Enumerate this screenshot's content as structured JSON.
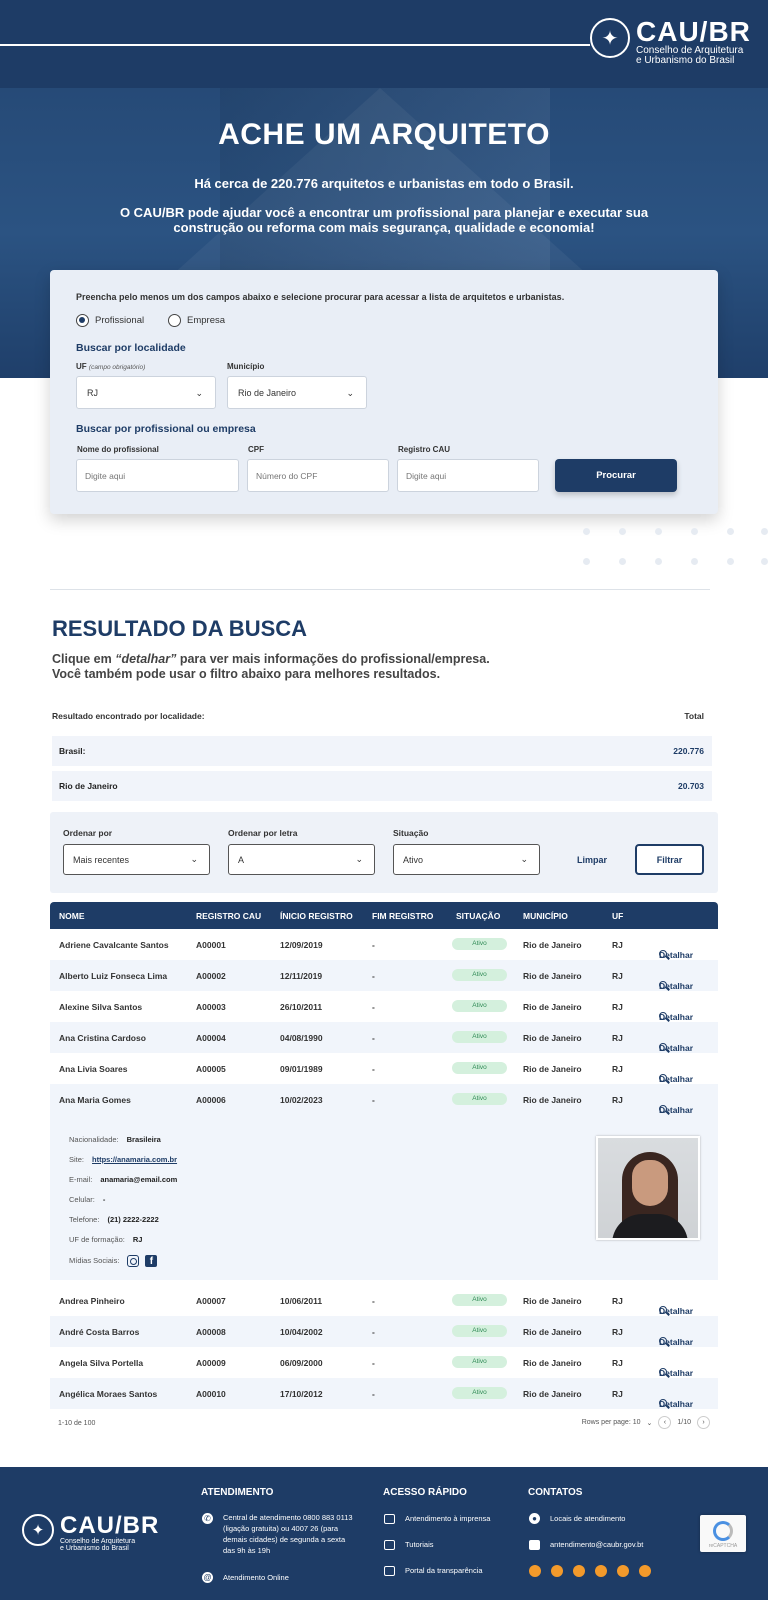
{
  "header": {
    "brand": "CAU/BR",
    "brand_sub_1": "Conselho de Arquitetura",
    "brand_sub_2": "e Urbanismo do Brasil"
  },
  "hero": {
    "title": "ACHE UM ARQUITETO",
    "line1": "Há cerca de 220.776 arquitetos e urbanistas em todo o Brasil.",
    "line2": "O CAU/BR pode ajudar você a encontrar um profissional para planejar e executar sua construção ou reforma com mais segurança, qualidade e economia!"
  },
  "search": {
    "instructions": "Preencha pelo menos um dos campos abaixo e selecione procurar para acessar a lista de arquitetos e urbanistas.",
    "radio_profissional": "Profissional",
    "radio_empresa": "Empresa",
    "section_localidade": "Buscar por localidade",
    "uf_label": "UF",
    "uf_note": "(campo obrigatório)",
    "uf_value": "RJ",
    "municipio_label": "Município",
    "municipio_value": "Rio de Janeiro",
    "section_profissional": "Buscar por profissional ou empresa",
    "nome_label": "Nome do profissional",
    "nome_placeholder": "Digite aqui",
    "cpf_label": "CPF",
    "cpf_placeholder": "Número do CPF",
    "registro_label": "Registro CAU",
    "registro_placeholder": "Digite aqui",
    "button": "Procurar"
  },
  "results": {
    "title": "RESULTADO DA BUSCA",
    "sub_pre": "Clique em ",
    "sub_em": "“detalhar”",
    "sub_post": " para ver mais informações do profissional/empresa.",
    "sub_line2": "Você também pode usar o filtro abaixo para melhores resultados.",
    "loc_header": "Resultado encontrado por localidade:",
    "total_header": "Total",
    "brasil_label": "Brasil:",
    "brasil_total": "220.776",
    "rj_label": "Rio de Janeiro",
    "rj_total": "20.703"
  },
  "filters": {
    "ordenar_label": "Ordenar por",
    "ordenar_value": "Mais recentes",
    "letra_label": "Ordenar por letra",
    "letra_value": "A",
    "situacao_label": "Situação",
    "situacao_value": "Ativo",
    "limpar": "Limpar",
    "filtrar": "Filtrar"
  },
  "table": {
    "columns": [
      "NOME",
      "REGISTRO CAU",
      "ÍNICIO REGISTRO",
      "FIM REGISTRO",
      "SITUAÇÃO",
      "MUNICÍPIO",
      "UF"
    ],
    "detail_label": "Detalhar",
    "rows": [
      {
        "nome": "Adriene Cavalcante Santos",
        "registro": "A00001",
        "inicio": "12/09/2019",
        "fim": "-",
        "situacao": "Ativo",
        "municipio": "Rio de Janeiro",
        "uf": "RJ"
      },
      {
        "nome": "Alberto Luiz Fonseca Lima",
        "registro": "A00002",
        "inicio": "12/11/2019",
        "fim": "-",
        "situacao": "Ativo",
        "municipio": "Rio de Janeiro",
        "uf": "RJ"
      },
      {
        "nome": "Alexine Silva Santos",
        "registro": "A00003",
        "inicio": "26/10/2011",
        "fim": "-",
        "situacao": "Ativo",
        "municipio": "Rio de Janeiro",
        "uf": "RJ"
      },
      {
        "nome": "Ana Cristina Cardoso",
        "registro": "A00004",
        "inicio": "04/08/1990",
        "fim": "-",
        "situacao": "Ativo",
        "municipio": "Rio de Janeiro",
        "uf": "RJ"
      },
      {
        "nome": "Ana Livia Soares",
        "registro": "A00005",
        "inicio": "09/01/1989",
        "fim": "-",
        "situacao": "Ativo",
        "municipio": "Rio de Janeiro",
        "uf": "RJ"
      },
      {
        "nome": "Ana Maria Gomes",
        "registro": "A00006",
        "inicio": "10/02/2023",
        "fim": "-",
        "situacao": "Ativo",
        "municipio": "Rio de Janeiro",
        "uf": "RJ"
      },
      {
        "nome": "Andrea Pinheiro",
        "registro": "A00007",
        "inicio": "10/06/2011",
        "fim": "-",
        "situacao": "Ativo",
        "municipio": "Rio de Janeiro",
        "uf": "RJ"
      },
      {
        "nome": "André Costa Barros",
        "registro": "A00008",
        "inicio": "10/04/2002",
        "fim": "-",
        "situacao": "Ativo",
        "municipio": "Rio de Janeiro",
        "uf": "RJ"
      },
      {
        "nome": "Angela Silva Portella",
        "registro": "A00009",
        "inicio": "06/09/2000",
        "fim": "-",
        "situacao": "Ativo",
        "municipio": "Rio de Janeiro",
        "uf": "RJ"
      },
      {
        "nome": "Angélica Moraes Santos",
        "registro": "A00010",
        "inicio": "17/10/2012",
        "fim": "-",
        "situacao": "Ativo",
        "municipio": "Rio de Janeiro",
        "uf": "RJ"
      }
    ],
    "detail": {
      "nacionalidade_label": "Nacionalidade:",
      "nacionalidade": "Brasileira",
      "site_label": "Site:",
      "site": "https://anamaria.com.br",
      "email_label": "E-mail:",
      "email": "anamaria@email.com",
      "celular_label": "Celular:",
      "celular": "-",
      "telefone_label": "Telefone:",
      "telefone": "(21) 2222-2222",
      "uf_formacao_label": "UF de formação:",
      "uf_formacao": "RJ",
      "midias_label": "Mídias Sociais:"
    },
    "pagination": {
      "range": "1-10 de 100",
      "rows_per_page": "Rows per page: 10",
      "page": "1/10"
    }
  },
  "footer": {
    "atendimento_title": "ATENDIMENTO",
    "central": "Central de atendimento 0800 883 0113 (ligação gratuita) ou 4007 26 (para demais cidades) de segunda a sexta das 9h às 19h",
    "online": "Atendimento Online",
    "acesso_title": "ACESSO RÁPIDO",
    "acesso_items": [
      "Antendimento à imprensa",
      "Tutoriais",
      "Portal da transparência"
    ],
    "contatos_title": "CONTATOS",
    "locais": "Locais de atendimento",
    "email": "antendimento@caubr.gov.bt",
    "recaptcha": "reCAPTCHA"
  }
}
